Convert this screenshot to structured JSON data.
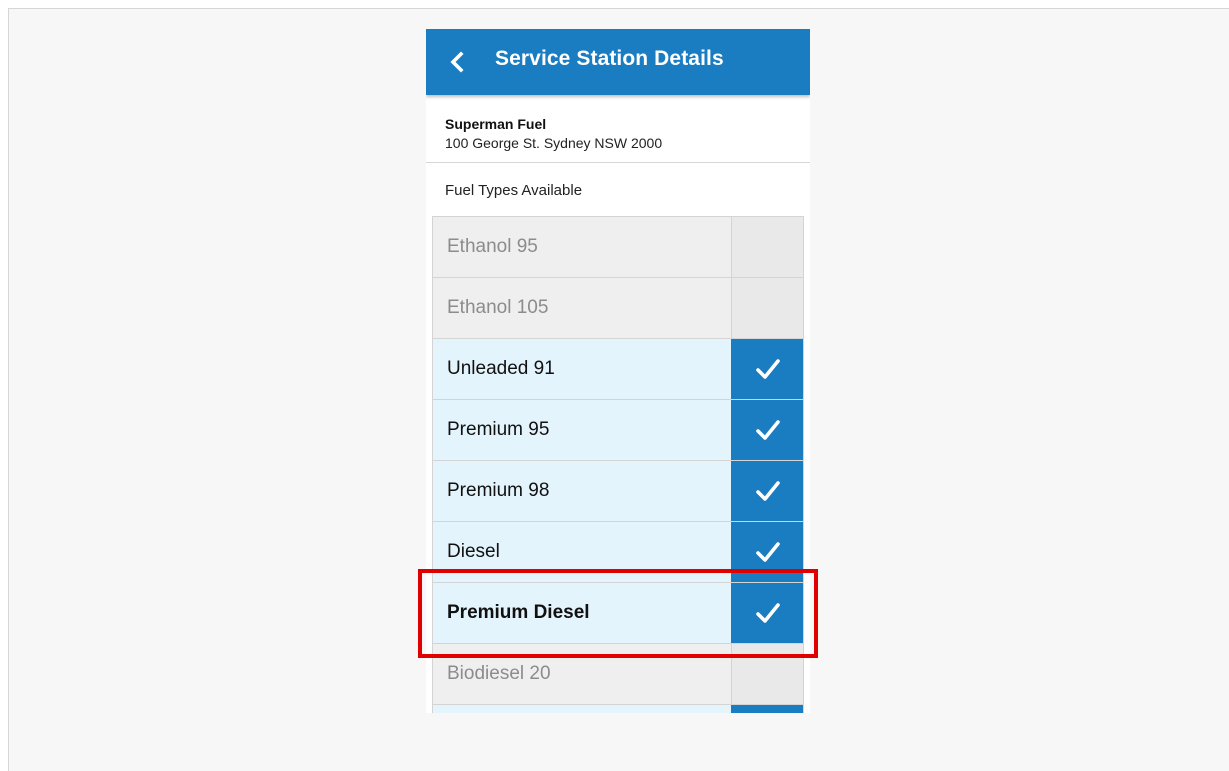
{
  "appbar": {
    "title": "Service Station Details",
    "back_icon": "chevron-left-icon"
  },
  "station": {
    "name": "Superman Fuel",
    "address": "100 George St. Sydney NSW 2000"
  },
  "fuel_section": {
    "label": "Fuel Types Available",
    "items": [
      {
        "label": "Ethanol 95",
        "available": false
      },
      {
        "label": "Ethanol 105",
        "available": false
      },
      {
        "label": "Unleaded 91",
        "available": true
      },
      {
        "label": "Premium 95",
        "available": true
      },
      {
        "label": "Premium 98",
        "available": true
      },
      {
        "label": "Diesel",
        "available": true
      },
      {
        "label": "Premium Diesel",
        "available": true,
        "highlighted": true
      },
      {
        "label": "Biodiesel 20",
        "available": false
      },
      {
        "label": "",
        "available": true
      }
    ]
  },
  "colors": {
    "primary": "#1a7cc1",
    "selected_row": "#e3f4fc",
    "unselected_row": "#efefef",
    "highlight": "#e00000"
  }
}
